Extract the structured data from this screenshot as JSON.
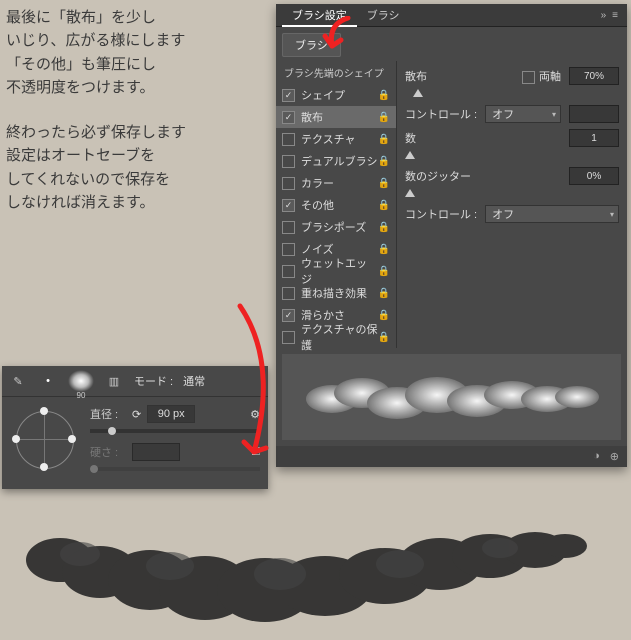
{
  "instructions": {
    "p1_l1": "最後に「散布」を少し",
    "p1_l2": "いじり、広がる様にします",
    "p1_l3": "「その他」も筆圧にし",
    "p1_l4": "不透明度をつけます。",
    "p2_l1": "終わったら必ず保存します",
    "p2_l2": "設定はオートセーブを",
    "p2_l3": "してくれないので保存を",
    "p2_l4": "しなければ消えます。"
  },
  "panel": {
    "tabs": {
      "a": "ブラシ設定",
      "b": "ブラシ"
    },
    "subtab": "ブラシ",
    "left_header": "ブラシ先端のシェイプ",
    "rows": [
      {
        "label": "シェイプ",
        "checked": true,
        "lock": true,
        "selected": false
      },
      {
        "label": "散布",
        "checked": true,
        "lock": true,
        "selected": true
      },
      {
        "label": "テクスチャ",
        "checked": false,
        "lock": true,
        "selected": false
      },
      {
        "label": "デュアルブラシ",
        "checked": false,
        "lock": true,
        "selected": false
      },
      {
        "label": "カラー",
        "checked": false,
        "lock": true,
        "selected": false
      },
      {
        "label": "その他",
        "checked": true,
        "lock": true,
        "selected": false
      },
      {
        "label": "ブラシポーズ",
        "checked": false,
        "lock": true,
        "selected": false
      },
      {
        "label": "ノイズ",
        "checked": false,
        "lock": true,
        "selected": false
      },
      {
        "label": "ウェットエッジ",
        "checked": false,
        "lock": true,
        "selected": false
      },
      {
        "label": "重ね描き効果",
        "checked": false,
        "lock": true,
        "selected": false
      },
      {
        "label": "滑らかさ",
        "checked": true,
        "lock": true,
        "selected": false
      },
      {
        "label": "テクスチャの保護",
        "checked": false,
        "lock": true,
        "selected": false
      }
    ],
    "right": {
      "scatter_label": "散布",
      "both_axes_label": "両軸",
      "scatter_value": "70%",
      "control_label": "コントロール :",
      "control_value": "オフ",
      "count_label": "数",
      "count_value": "1",
      "count_jitter_label": "数のジッター",
      "count_jitter_value": "0%"
    }
  },
  "toolbar": {
    "brush_size_thumb": "90",
    "mode_label": "モード :",
    "mode_value": "通常",
    "diameter_label": "直径 :",
    "diameter_value": "90 px",
    "hardness_label": "硬さ :"
  }
}
